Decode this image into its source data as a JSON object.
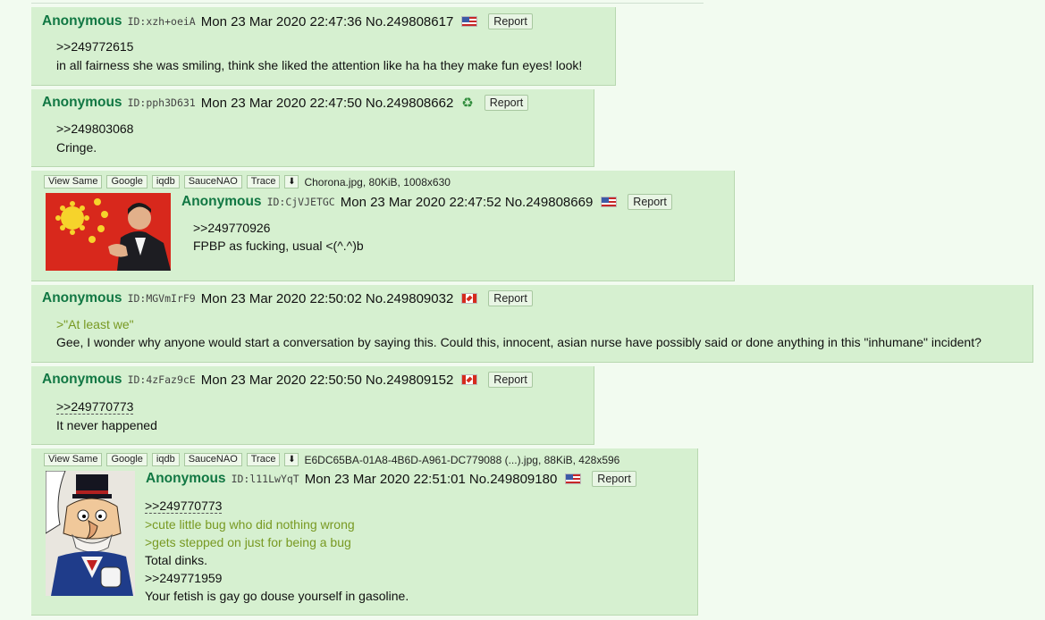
{
  "posts": [
    {
      "name": "Anonymous",
      "id": "ID:xzh+oeiA",
      "datetime": "Mon 23 Mar 2020 22:47:36",
      "number": "No.249808617",
      "flag": "us",
      "report": "Report",
      "lines": [
        ">>249772615",
        "in all fairness she was smiling, think she liked the attention like ha ha they make fun eyes! look!"
      ]
    },
    {
      "name": "Anonymous",
      "id": "ID:pph3D631",
      "datetime": "Mon 23 Mar 2020 22:47:50",
      "number": "No.249808662",
      "flag": "recycle",
      "report": "Report",
      "lines": [
        ">>249803068",
        "Cringe."
      ]
    },
    {
      "toolbar": [
        "View Same",
        "Google",
        "iqdb",
        "SauceNAO",
        "Trace"
      ],
      "file": "Chorona.jpg, 80KiB, 1008x630",
      "name": "Anonymous",
      "id": "ID:CjVJETGC",
      "datetime": "Mon 23 Mar 2020 22:47:52",
      "number": "No.249808669",
      "flag": "us",
      "report": "Report",
      "lines": [
        ">>249770926",
        "FPBP as fucking, usual <(^.^)b"
      ]
    },
    {
      "name": "Anonymous",
      "id": "ID:MGVmIrF9",
      "datetime": "Mon 23 Mar 2020 22:50:02",
      "number": "No.249809032",
      "flag": "ca",
      "report": "Report",
      "lines": [
        ">\"At least we\"",
        "Gee, I wonder why anyone would start a conversation by saying this. Could this, innocent, asian nurse have possibly said or done anything in this \"inhumane\" incident?"
      ]
    },
    {
      "name": "Anonymous",
      "id": "ID:4zFaz9cE",
      "datetime": "Mon 23 Mar 2020 22:50:50",
      "number": "No.249809152",
      "flag": "ca",
      "report": "Report",
      "lines": [
        ">>249770773",
        "It never happened"
      ]
    },
    {
      "toolbar": [
        "View Same",
        "Google",
        "iqdb",
        "SauceNAO",
        "Trace"
      ],
      "file": "E6DC65BA-01A8-4B6D-A961-DC779088 (...).jpg, 88KiB, 428x596",
      "name": "Anonymous",
      "id": "ID:l11LwYqT",
      "datetime": "Mon 23 Mar 2020 22:51:01",
      "number": "No.249809180",
      "flag": "us",
      "report": "Report",
      "lines": [
        ">>249770773",
        ">cute little bug who did nothing wrong",
        ">gets stepped on just for being a bug",
        "Total dinks.",
        ">>249771959",
        "Your fetish is gay go douse yourself in gasoline."
      ]
    }
  ],
  "colors": {
    "background": "#f2fbf0",
    "post_bg": "#d6f0d0",
    "name": "#117743",
    "greentext": "#789922"
  }
}
